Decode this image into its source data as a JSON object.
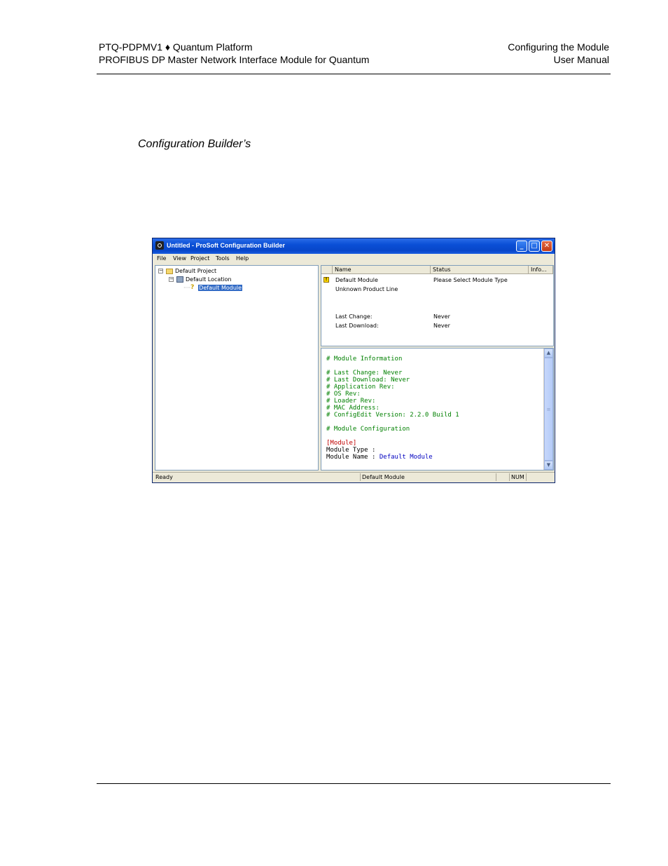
{
  "header": {
    "left_line1": "PTQ-PDPMV1 ♦ Quantum Platform",
    "left_line2": "PROFIBUS DP Master Network Interface Module for Quantum",
    "right_line1": "Configuring the Module",
    "right_line2": "User Manual"
  },
  "caption": "Configuration Builder’s",
  "window": {
    "title": "Untitled - ProSoft Configuration Builder",
    "buttons": {
      "minimize": "_",
      "maximize": "□",
      "close": "✕"
    },
    "menu": [
      "File",
      "View",
      "Project",
      "Tools",
      "Help"
    ],
    "tree": {
      "project": "Default Project",
      "location": "Default Location",
      "module": "Default Module",
      "collapse_glyph": "−"
    },
    "list": {
      "columns": [
        "Name",
        "Status",
        "Info..."
      ],
      "rows": [
        {
          "name": "Default Module",
          "status": "Please Select Module Type"
        },
        {
          "name": "Unknown Product Line",
          "status": ""
        },
        {
          "name": "Last Change:",
          "status": "Never"
        },
        {
          "name": "Last Download:",
          "status": "Never"
        }
      ],
      "warning_glyph": "!"
    },
    "config_text": {
      "l1": "# Module Information",
      "l2": "# Last Change: Never",
      "l3": "# Last Download: Never",
      "l4": "# Application Rev:",
      "l5": "# OS Rev:",
      "l6": "# Loader Rev:",
      "l7": "# MAC Address:",
      "l8": "# ConfigEdit Version: 2.2.0 Build 1",
      "l9": "# Module Configuration",
      "l10": "[Module]",
      "l11": "Module Type :",
      "l12_key": "Module Name : ",
      "l12_val": "Default Module"
    },
    "scroll": {
      "up": "▲",
      "down": "▼",
      "grip": "≡"
    },
    "status": {
      "left": "Ready",
      "middle": "Default Module",
      "num": "NUM"
    }
  }
}
